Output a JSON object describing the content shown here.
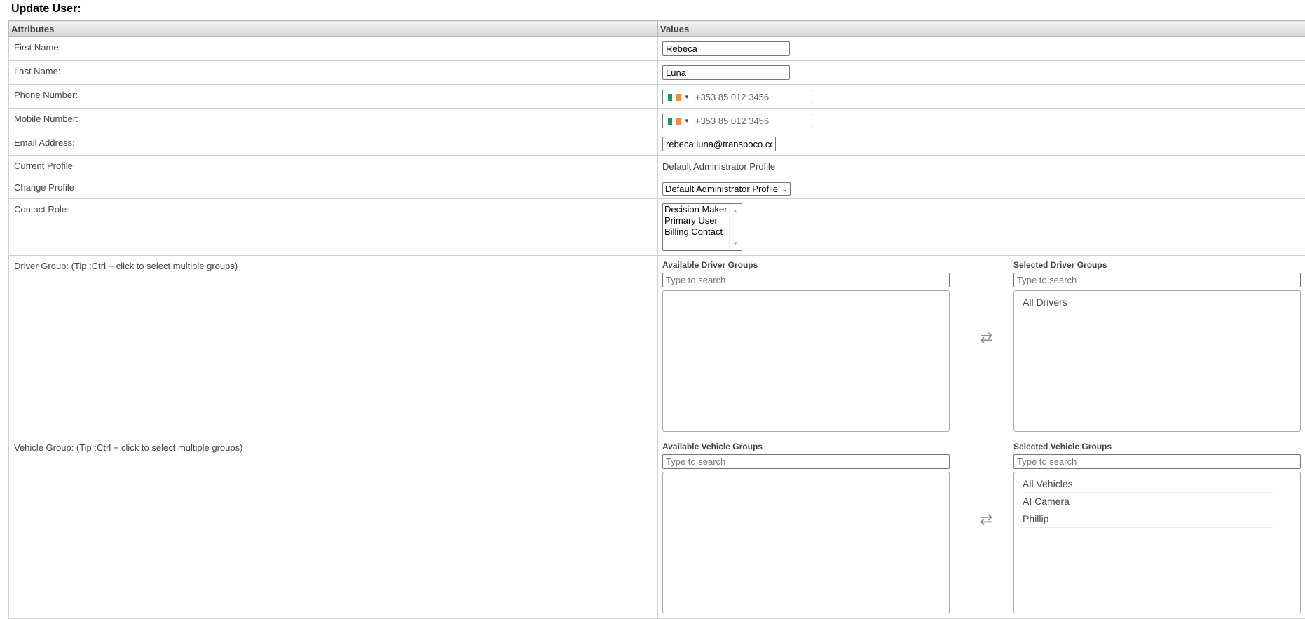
{
  "page_title": "Update User:",
  "table": {
    "col_attributes": "Attributes",
    "col_values": "Values"
  },
  "fields": {
    "first_name": {
      "label": "First Name:",
      "value": "Rebeca"
    },
    "last_name": {
      "label": "Last Name:",
      "value": "Luna"
    },
    "phone": {
      "label": "Phone Number:",
      "placeholder": "+353 85 012 3456",
      "country": "Ireland"
    },
    "mobile": {
      "label": "Mobile Number:",
      "placeholder": "+353 85 012 3456",
      "country": "Ireland"
    },
    "email": {
      "label": "Email Address:",
      "value": "rebeca.luna@transpoco.com"
    },
    "current_profile": {
      "label": "Current Profile",
      "value": "Default Administrator Profile"
    },
    "change_profile": {
      "label": "Change Profile",
      "selected": "Default Administrator Profile"
    },
    "contact_role": {
      "label": "Contact Role:",
      "options": [
        "Decision Maker",
        "Primary User",
        "Billing Contact"
      ]
    }
  },
  "driver_group": {
    "label": "Driver Group: (Tip :Ctrl + click to select multiple groups)",
    "available_title": "Available Driver Groups",
    "selected_title": "Selected Driver Groups",
    "search_placeholder": "Type to search",
    "available": [],
    "selected": [
      "All Drivers"
    ]
  },
  "vehicle_group": {
    "label": "Vehicle Group: (Tip :Ctrl + click to select multiple groups)",
    "available_title": "Available Vehicle Groups",
    "selected_title": "Selected Vehicle Groups",
    "search_placeholder": "Type to search",
    "available": [],
    "selected": [
      "All Vehicles",
      "AI Camera",
      "Phillip"
    ]
  },
  "colors": {
    "flag_green": "#169b62",
    "flag_white": "#ffffff",
    "flag_orange": "#ff883e"
  }
}
